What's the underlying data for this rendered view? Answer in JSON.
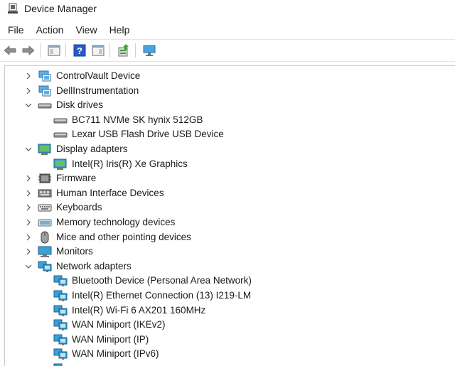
{
  "window": {
    "title": "Device Manager"
  },
  "menu": [
    "File",
    "Action",
    "View",
    "Help"
  ],
  "tree": [
    {
      "label": "ControlVault Device",
      "level": 0,
      "state": "collapsed",
      "icon": "pc-card-icon"
    },
    {
      "label": "DellInstrumentation",
      "level": 0,
      "state": "collapsed",
      "icon": "pc-card-icon"
    },
    {
      "label": "Disk drives",
      "level": 0,
      "state": "expanded",
      "icon": "disk-drive-icon"
    },
    {
      "label": "BC711 NVMe SK hynix 512GB",
      "level": 1,
      "icon": "disk-drive-icon"
    },
    {
      "label": "Lexar USB Flash Drive USB Device",
      "level": 1,
      "icon": "disk-drive-icon"
    },
    {
      "label": "Display adapters",
      "level": 0,
      "state": "expanded",
      "icon": "display-adapter-icon"
    },
    {
      "label": "Intel(R) Iris(R) Xe Graphics",
      "level": 1,
      "icon": "display-adapter-icon"
    },
    {
      "label": "Firmware",
      "level": 0,
      "state": "collapsed",
      "icon": "firmware-icon"
    },
    {
      "label": "Human Interface Devices",
      "level": 0,
      "state": "collapsed",
      "icon": "hid-icon"
    },
    {
      "label": "Keyboards",
      "level": 0,
      "state": "collapsed",
      "icon": "keyboard-icon"
    },
    {
      "label": "Memory technology devices",
      "level": 0,
      "state": "collapsed",
      "icon": "memory-icon"
    },
    {
      "label": "Mice and other pointing devices",
      "level": 0,
      "state": "collapsed",
      "icon": "mouse-icon"
    },
    {
      "label": "Monitors",
      "level": 0,
      "state": "collapsed",
      "icon": "monitor-icon"
    },
    {
      "label": "Network adapters",
      "level": 0,
      "state": "expanded",
      "icon": "network-adapter-icon"
    },
    {
      "label": "Bluetooth Device (Personal Area Network)",
      "level": 1,
      "icon": "network-adapter-icon"
    },
    {
      "label": "Intel(R) Ethernet Connection (13) I219-LM",
      "level": 1,
      "icon": "network-adapter-icon"
    },
    {
      "label": "Intel(R) Wi-Fi 6 AX201 160MHz",
      "level": 1,
      "icon": "network-adapter-icon"
    },
    {
      "label": "WAN Miniport (IKEv2)",
      "level": 1,
      "icon": "network-adapter-icon"
    },
    {
      "label": "WAN Miniport (IP)",
      "level": 1,
      "icon": "network-adapter-icon"
    },
    {
      "label": "WAN Miniport (IPv6)",
      "level": 1,
      "icon": "network-adapter-icon"
    },
    {
      "label": "",
      "level": 1,
      "icon": "network-adapter-icon"
    }
  ]
}
